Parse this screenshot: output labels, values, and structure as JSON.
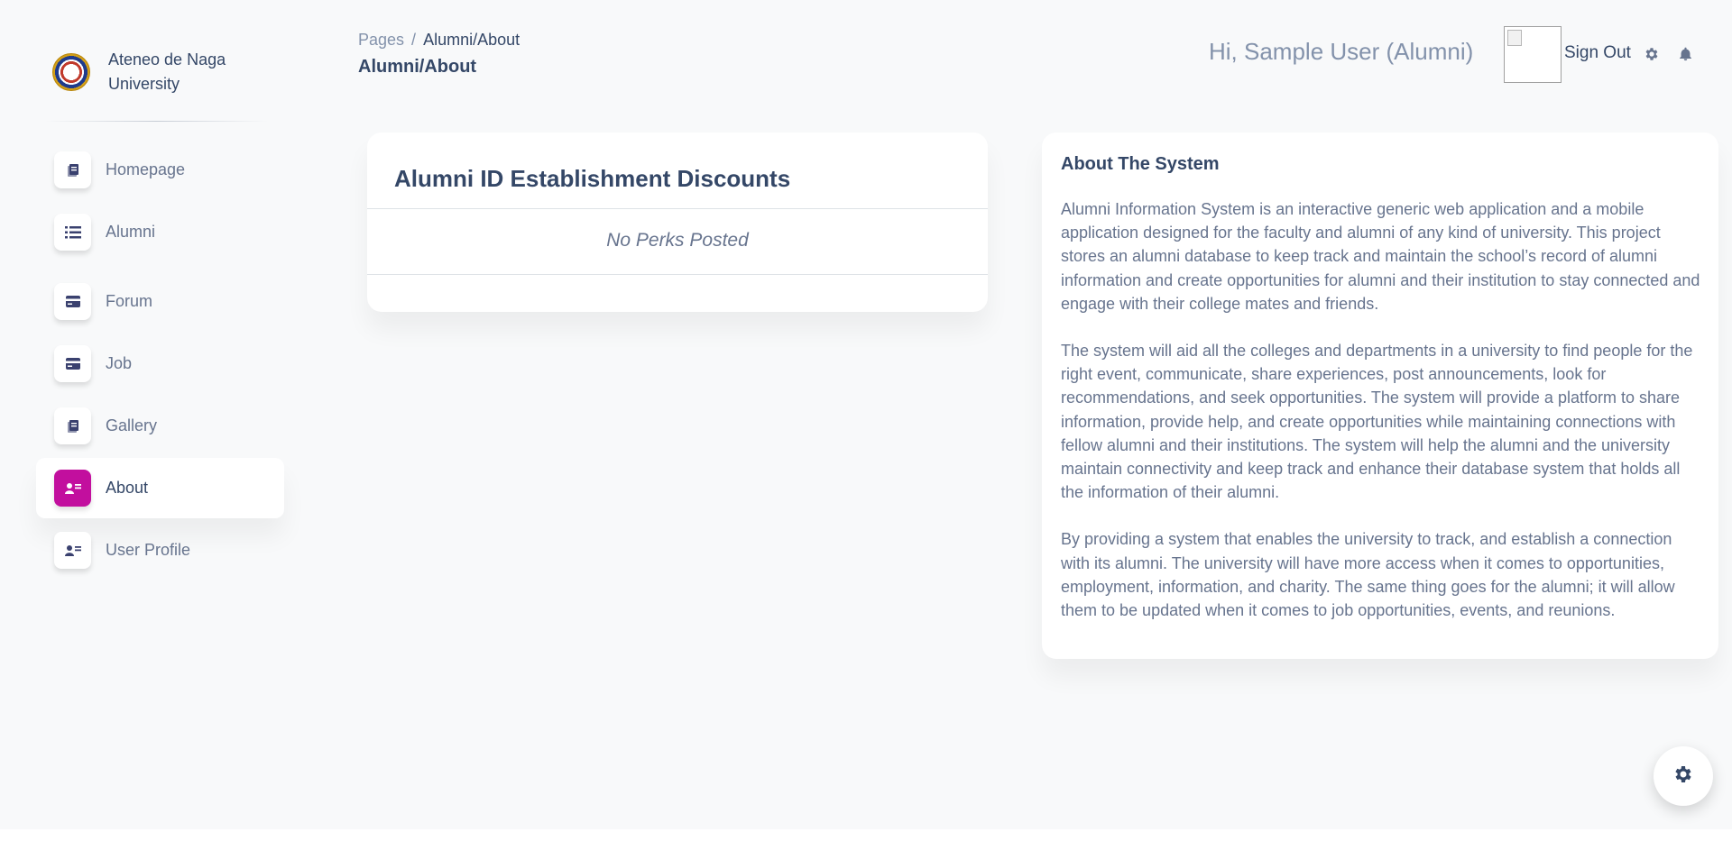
{
  "sidebar": {
    "brand_name": "Ateneo de Naga University",
    "items": [
      {
        "label": "Homepage",
        "icon": "document-icon"
      },
      {
        "label": "Alumni",
        "icon": "list-icon"
      },
      {
        "label": "Forum",
        "icon": "credit-card-icon"
      },
      {
        "label": "Job",
        "icon": "credit-card-icon"
      },
      {
        "label": "Gallery",
        "icon": "document-icon"
      },
      {
        "label": "About",
        "icon": "user-card-icon",
        "active": true
      },
      {
        "label": "User Profile",
        "icon": "user-card-icon"
      }
    ]
  },
  "header": {
    "breadcrumb_root": "Pages",
    "breadcrumb_separator": "/",
    "breadcrumb_current": "Alumni/About",
    "page_title": "Alumni/About",
    "greeting": "Hi, Sample User (Alumni)",
    "sign_out": "Sign Out"
  },
  "perks_card": {
    "title": "Alumni ID Establishment Discounts",
    "empty_message": "No Perks Posted"
  },
  "about_card": {
    "title": "About The System",
    "paragraphs": [
      "Alumni Information System is an interactive generic web application and a mobile application designed for the faculty and alumni of any kind of university. This project stores an alumni database to keep track and maintain the school’s record of alumni information and create opportunities for alumni and their institution to stay connected and engage with their college mates and friends.",
      "The system will aid all the colleges and departments in a university to find people for the right event, communicate, share experiences, post announcements, look for recommendations, and seek opportunities. The system will provide a platform to share information, provide help, and create opportunities while maintaining connections with fellow alumni and their institutions. The system will help the alumni and the university maintain connectivity and keep track and enhance their database system that holds all the information of their alumni.",
      "By providing a system that enables the university to track, and establish a connection with its alumni. The university will have more access when it comes to opportunities, employment, information, and charity. The same thing goes for the alumni; it will allow them to be updated when it comes to job opportunities, events, and reunions."
    ]
  },
  "colors": {
    "accent": "#c20f9e",
    "text_dark": "#344767",
    "text_muted": "#67748e",
    "background": "#f8f9fa"
  }
}
